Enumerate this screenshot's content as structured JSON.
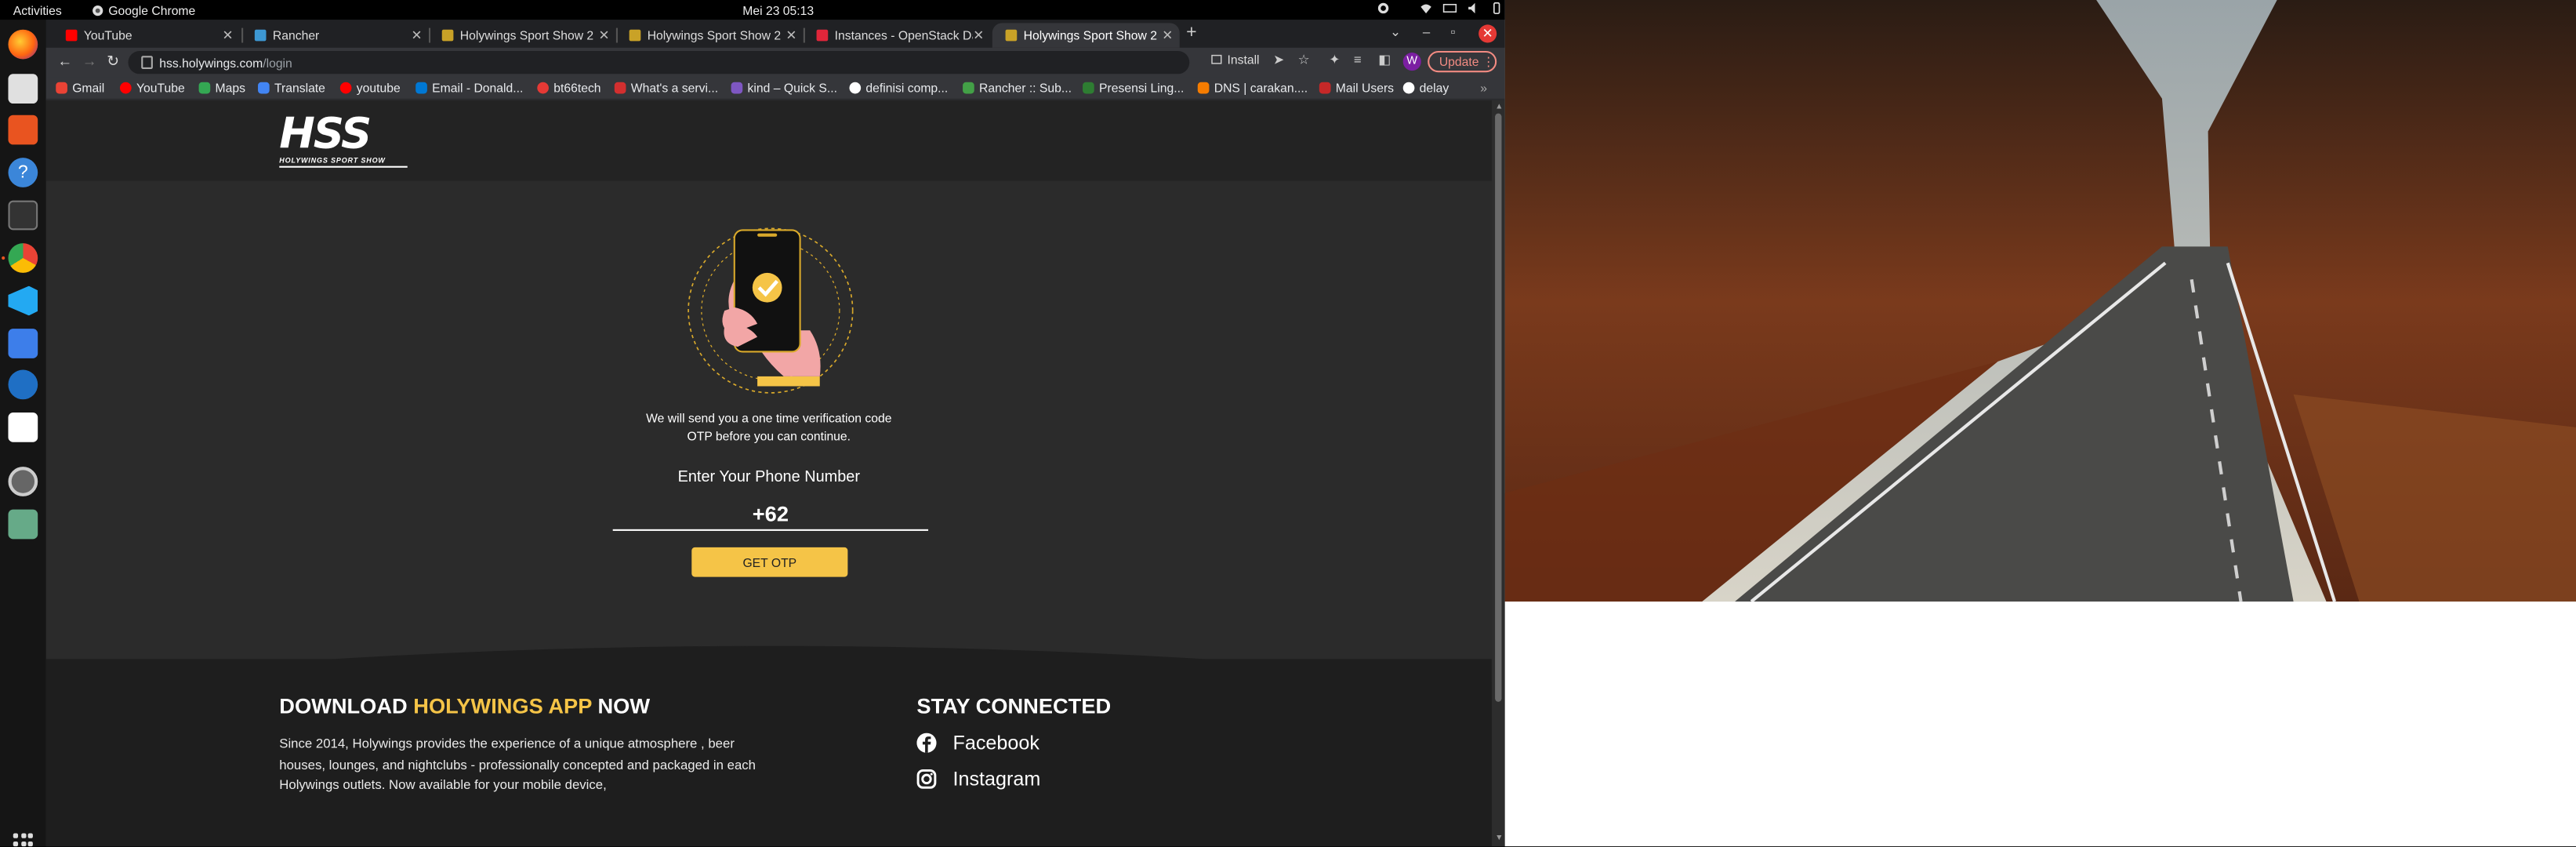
{
  "system": {
    "activities": "Activities",
    "app_name": "Google Chrome",
    "clock": "Mei 23  05:13"
  },
  "tabs": [
    {
      "title": "YouTube",
      "color": "#ff0000"
    },
    {
      "title": "Rancher",
      "color": "#3d98d3"
    },
    {
      "title": "Holywings Sport Show 2",
      "color": "#c9a227"
    },
    {
      "title": "Holywings Sport Show 2",
      "color": "#c9a227"
    },
    {
      "title": "Instances - OpenStack Da",
      "color": "#e0263a"
    },
    {
      "title": "Holywings Sport Show 2",
      "color": "#c9a227"
    }
  ],
  "toolbar": {
    "url_host": "hss.holywings.com",
    "url_path": "/login",
    "install_label": "Install",
    "avatar_letter": "W",
    "update_label": "Update"
  },
  "bookmarks": [
    {
      "label": "Gmail",
      "color": "#ea4335"
    },
    {
      "label": "YouTube",
      "color": "#ff0000"
    },
    {
      "label": "Maps",
      "color": "#34a853"
    },
    {
      "label": "Translate",
      "color": "#4285f4"
    },
    {
      "label": "youtube",
      "color": "#ff0000"
    },
    {
      "label": "Email - Donald...",
      "color": "#0078d4"
    },
    {
      "label": "bt66tech",
      "color": "#e53935"
    },
    {
      "label": "What's a servi...",
      "color": "#d32f2f"
    },
    {
      "label": "kind – Quick S...",
      "color": "#7e57c2"
    },
    {
      "label": "definisi comp...",
      "color": "#ffffff"
    },
    {
      "label": "Rancher :: Sub...",
      "color": "#43a047"
    },
    {
      "label": "Presensi Ling...",
      "color": "#2e7d32"
    },
    {
      "label": "DNS | carakan....",
      "color": "#f57c00"
    },
    {
      "label": "Mail Users",
      "color": "#c62828"
    },
    {
      "label": "delay",
      "color": "#ffffff"
    }
  ],
  "page": {
    "logo_text": "HSS",
    "logo_subtext": "HOLYWINGS SPORT SHOW",
    "otp_line1": "We will send you a one time verification code",
    "otp_line2": "OTP before you can continue.",
    "phone_label": "Enter Your Phone Number",
    "phone_value": "+62",
    "otp_button": "GET OTP",
    "accent_color": "#f5c447"
  },
  "footer": {
    "download_prefix": "DOWNLOAD ",
    "download_highlight": "HOLYWINGS APP",
    "download_suffix": " NOW",
    "body": "Since 2014, Holywings provides the experience of a unique atmosphere , beer houses, lounges, and nightclubs - professionally concepted and packaged in each Holywings outlets. Now available for your mobile device,",
    "stay_connected": "STAY CONNECTED",
    "socials": [
      {
        "label": "Facebook",
        "icon": "facebook-icon"
      },
      {
        "label": "Instagram",
        "icon": "instagram-icon"
      }
    ]
  }
}
